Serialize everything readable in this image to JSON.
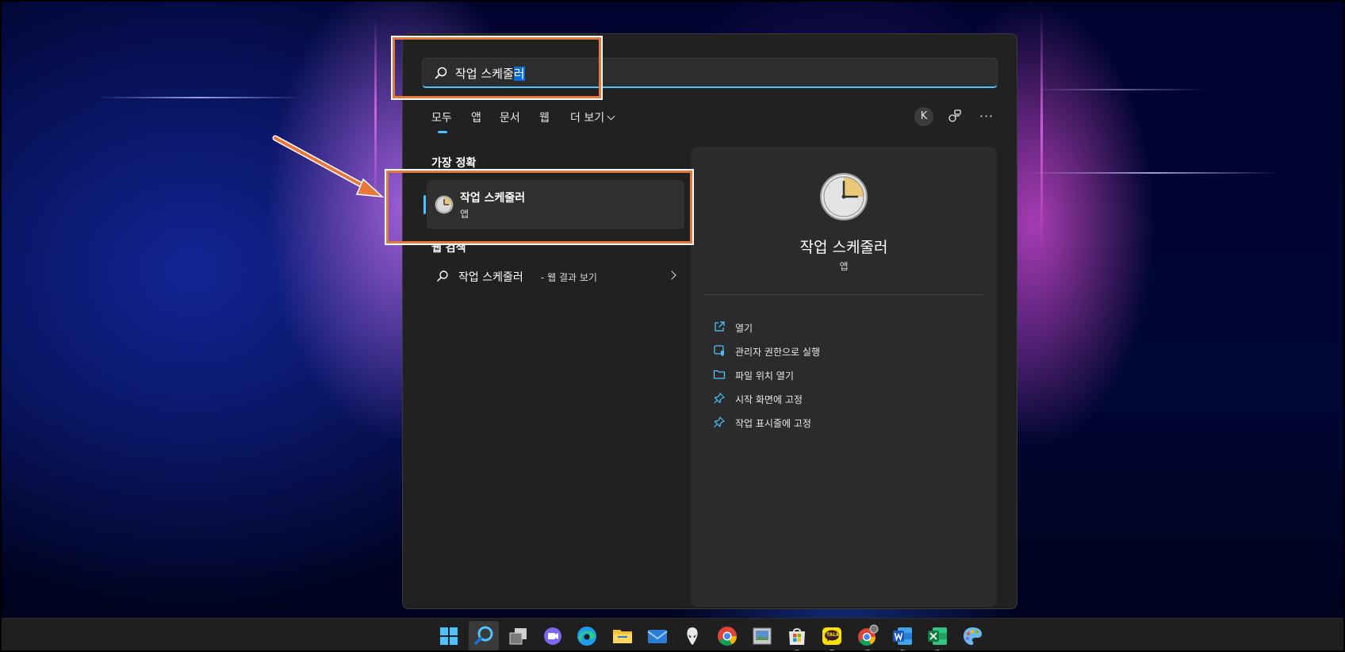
{
  "search": {
    "query_prefix": "작업 스케줄",
    "query_selected": "러"
  },
  "tabs": [
    {
      "label": "모두"
    },
    {
      "label": "앱"
    },
    {
      "label": "문서"
    },
    {
      "label": "웹"
    },
    {
      "label": "더 보기"
    }
  ],
  "account": {
    "initial": "K"
  },
  "more_menu": {
    "glyph": "···"
  },
  "best_match": {
    "heading": "가장 정확",
    "title": "작업 스케줄러",
    "subtitle": "앱"
  },
  "web_search": {
    "heading": "웹 검색",
    "query": "작업 스케줄러",
    "suffix": "- 웹 결과 보기"
  },
  "preview": {
    "title": "작업 스케줄러",
    "subtitle": "앱",
    "actions": [
      {
        "label": "열기",
        "icon": "open-external-icon"
      },
      {
        "label": "관리자 권한으로 실행",
        "icon": "admin-shield-icon"
      },
      {
        "label": "파일 위치 열기",
        "icon": "folder-icon"
      },
      {
        "label": "시작 화면에 고정",
        "icon": "pin-icon"
      },
      {
        "label": "작업 표시줄에 고정",
        "icon": "pin-icon"
      }
    ]
  },
  "taskbar": {
    "icons": [
      "windows-start-icon",
      "search-icon",
      "task-view-icon",
      "teams-chat-icon",
      "edge-icon",
      "file-explorer-icon",
      "mail-icon",
      "alienware-icon",
      "chrome-icon",
      "photo-viewer-icon",
      "microsoft-store-icon",
      "kakaotalk-icon",
      "chrome-profile-icon",
      "word-icon",
      "excel-icon",
      "paint-icon"
    ],
    "kakaotalk_label": "TALK"
  },
  "colors": {
    "accent": "#4cc2ff",
    "highlight_box": "#e8773a",
    "panel_bg": "#212121",
    "preview_bg": "#2b2b2b"
  }
}
